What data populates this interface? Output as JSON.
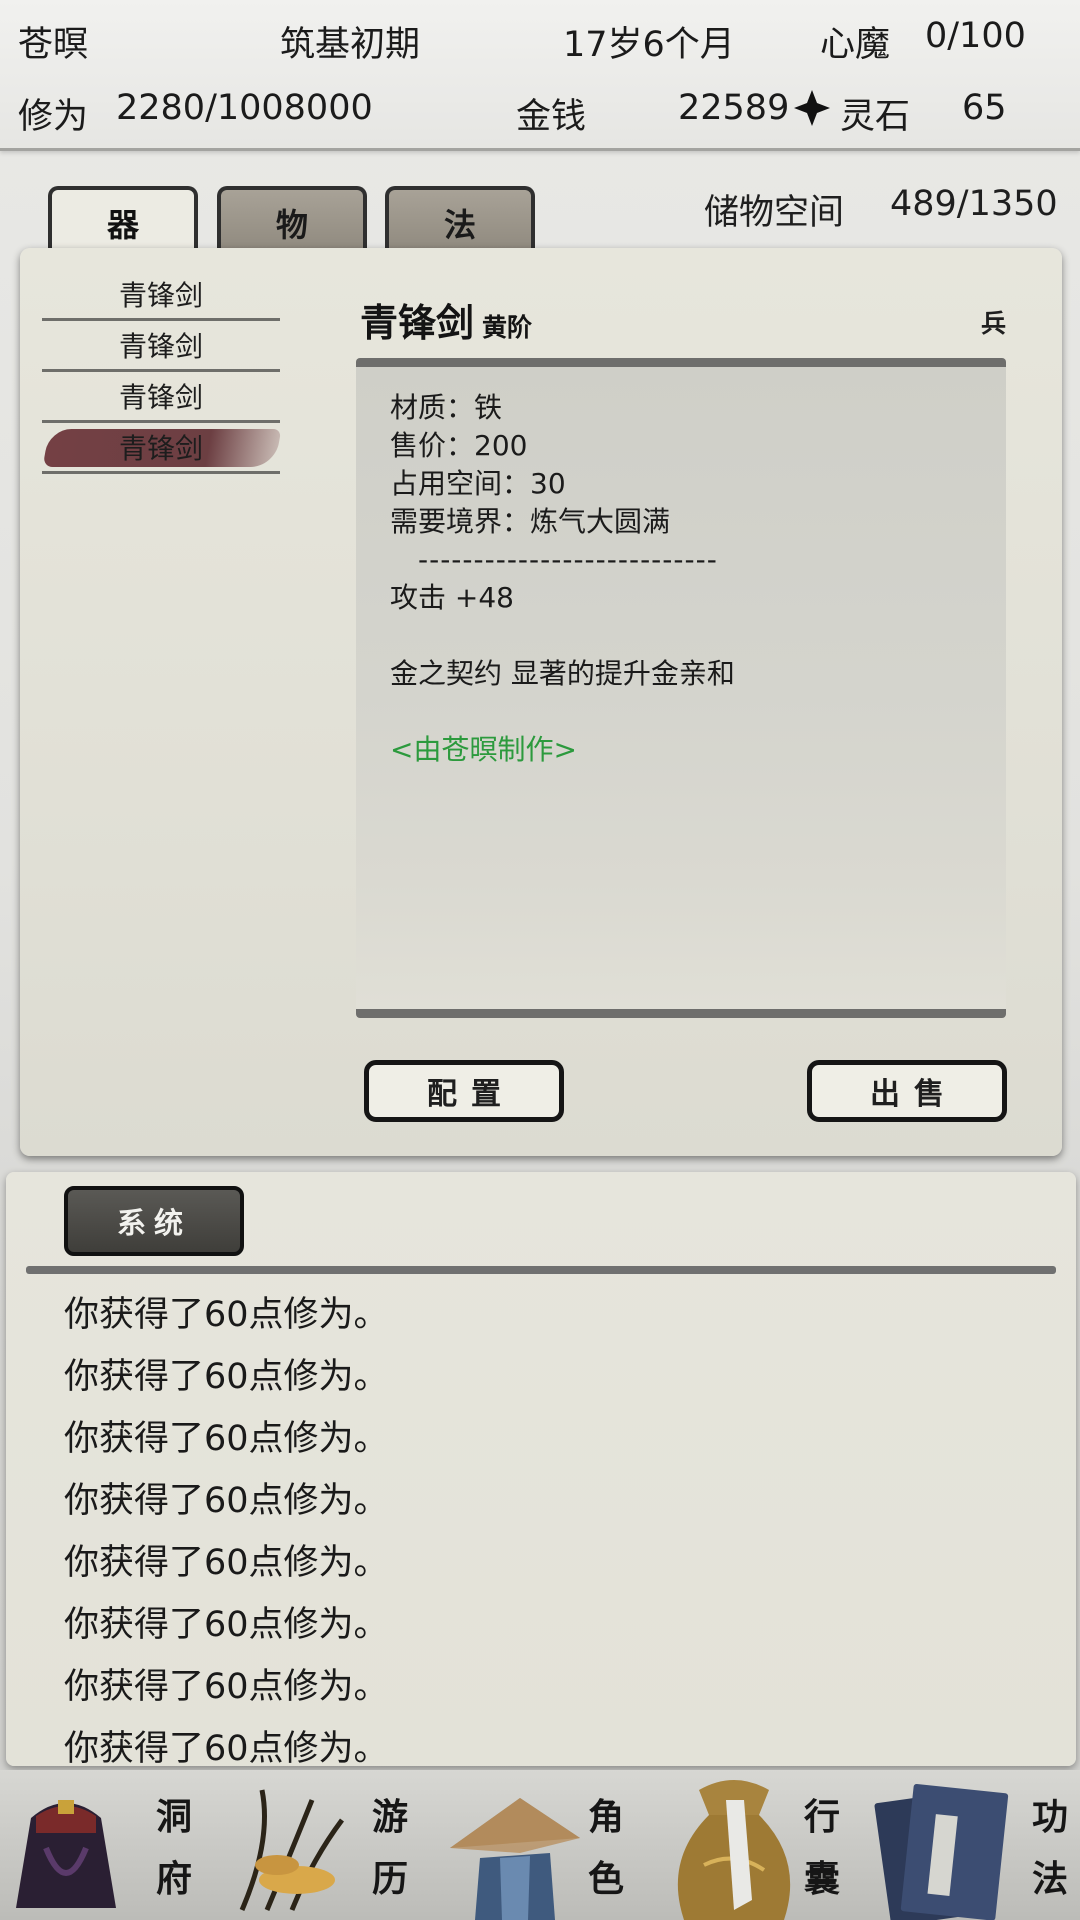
{
  "status": {
    "name": "苍暝",
    "realm": "筑基初期",
    "age": "17岁6个月",
    "demon_label": "心魔",
    "demon_value": "0/100",
    "cultivation_label": "修为",
    "cultivation_value": "2280/1008000",
    "money_label": "金钱",
    "money_value": "22589",
    "stone_label": "灵石",
    "stone_value": "65"
  },
  "tabs": [
    {
      "label": "器",
      "active": true
    },
    {
      "label": "物",
      "active": false
    },
    {
      "label": "法",
      "active": false
    }
  ],
  "storage": {
    "label": "储物空间",
    "value": "489/1350"
  },
  "items": [
    {
      "name": "青锋剑",
      "selected": false
    },
    {
      "name": "青锋剑",
      "selected": false
    },
    {
      "name": "青锋剑",
      "selected": false
    },
    {
      "name": "青锋剑",
      "selected": true
    }
  ],
  "detail": {
    "title": "青锋剑",
    "grade": "黄阶",
    "type": "兵",
    "material": "材质：铁",
    "price": "售价：200",
    "space": "占用空间：30",
    "realm_req": "需要境界：炼气大圆满",
    "separator": "---------------------------",
    "attack": "攻击 +48",
    "affix": "金之契约 显著的提升金亲和",
    "maker": "<由苍暝制作>"
  },
  "buttons": {
    "equip": "配置",
    "sell": "出售"
  },
  "log": {
    "tab_label": "系统",
    "lines": [
      "你获得了60点修为。",
      "你获得了60点修为。",
      "你获得了60点修为。",
      "你获得了60点修为。",
      "你获得了60点修为。",
      "你获得了60点修为。",
      "你获得了60点修为。",
      "你获得了60点修为。"
    ]
  },
  "nav": [
    {
      "top": "洞",
      "bottom": "府",
      "icon": "cave-dwelling-icon"
    },
    {
      "top": "游",
      "bottom": "历",
      "icon": "travel-icon"
    },
    {
      "top": "角",
      "bottom": "色",
      "icon": "character-icon"
    },
    {
      "top": "行",
      "bottom": "囊",
      "icon": "bag-icon"
    },
    {
      "top": "功",
      "bottom": "法",
      "icon": "technique-book-icon"
    }
  ],
  "colors": {
    "maker_green": "#2c9a3d",
    "selected_brush": "#6e373c"
  }
}
